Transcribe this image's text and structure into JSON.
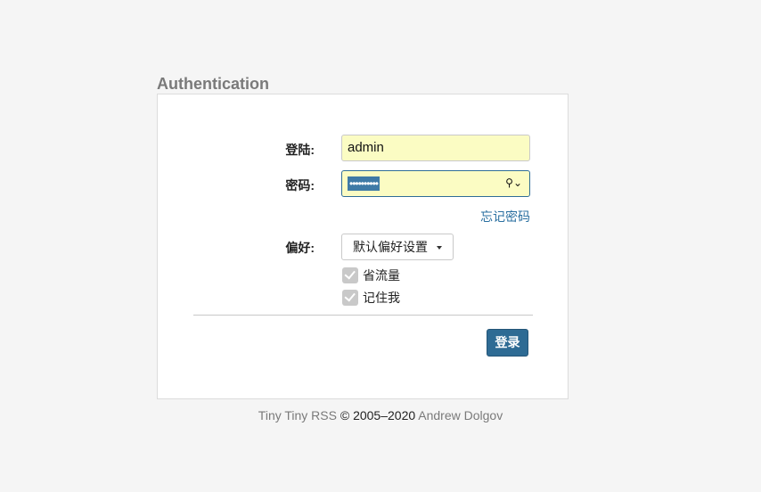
{
  "page": {
    "title": "Authentication"
  },
  "form": {
    "login_label": "登陆:",
    "login_value": "admin",
    "password_label": "密码:",
    "password_mask": "••••••••••",
    "forgot_password": "忘记密码",
    "prefs_label": "偏好:",
    "prefs_selected": "默认偏好设置",
    "checkboxes": [
      {
        "label": "省流量",
        "checked": true
      },
      {
        "label": "记住我",
        "checked": true
      }
    ],
    "login_button": "登录"
  },
  "footer": {
    "app": "Tiny Tiny RSS",
    "copyright": " © 2005–2020 ",
    "author": "Andrew Dolgov"
  },
  "icons": {
    "password_manager": "key-icon",
    "dropdown": "caret-down-icon"
  },
  "colors": {
    "accent": "#2e6b94",
    "input_bg": "#fbfcc3",
    "link": "#2a6fa0"
  }
}
